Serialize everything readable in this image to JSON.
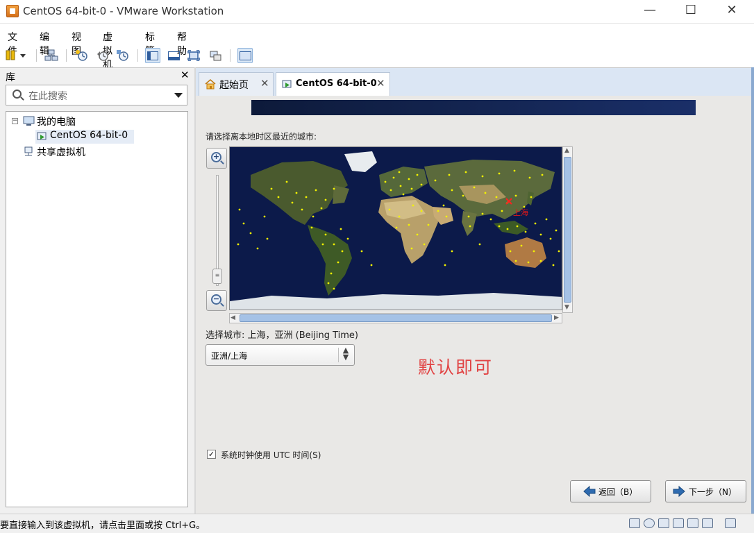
{
  "window": {
    "title": "CentOS 64-bit-0 - VMware Workstation",
    "minimize": "—",
    "maximize": "☐",
    "close": "✕"
  },
  "menu": [
    "文件",
    "编辑",
    "视图",
    "虚拟机",
    "标签",
    "帮助"
  ],
  "library": {
    "title": "库",
    "close": "✕",
    "search_placeholder": "在此搜索",
    "tree": {
      "my_computer": "我的电脑",
      "vm": "CentOS 64-bit-0",
      "shared": "共享虚拟机",
      "expander": "−"
    }
  },
  "tabs": [
    {
      "label": "起始页",
      "close": "✕",
      "active": false
    },
    {
      "label": "CentOS 64-bit-0",
      "close": "✕",
      "active": true
    }
  ],
  "installer": {
    "prompt": "请选择离本地时区最近的城市:",
    "map_city_marker": "上海",
    "zoom_in": "+",
    "zoom_out": "−",
    "selected_city_label": "选择城市: 上海，亚洲 (Beijing Time)",
    "timezone_value": "亚洲/上海",
    "note": "默认即可",
    "utc_checked": "✓",
    "utc_label": "系统时钟使用 UTC 时间(S)",
    "back_label": "返回（B）",
    "next_label": "下一步（N）"
  },
  "statusbar": {
    "text": "要直接输入到该虚拟机，请点击里面或按 Ctrl+G。"
  },
  "colors": {
    "accent": "#3d6eb5",
    "tab_strip": "#dbe6f4",
    "note": "#e14444",
    "map_ocean": "#0c1a4a"
  }
}
